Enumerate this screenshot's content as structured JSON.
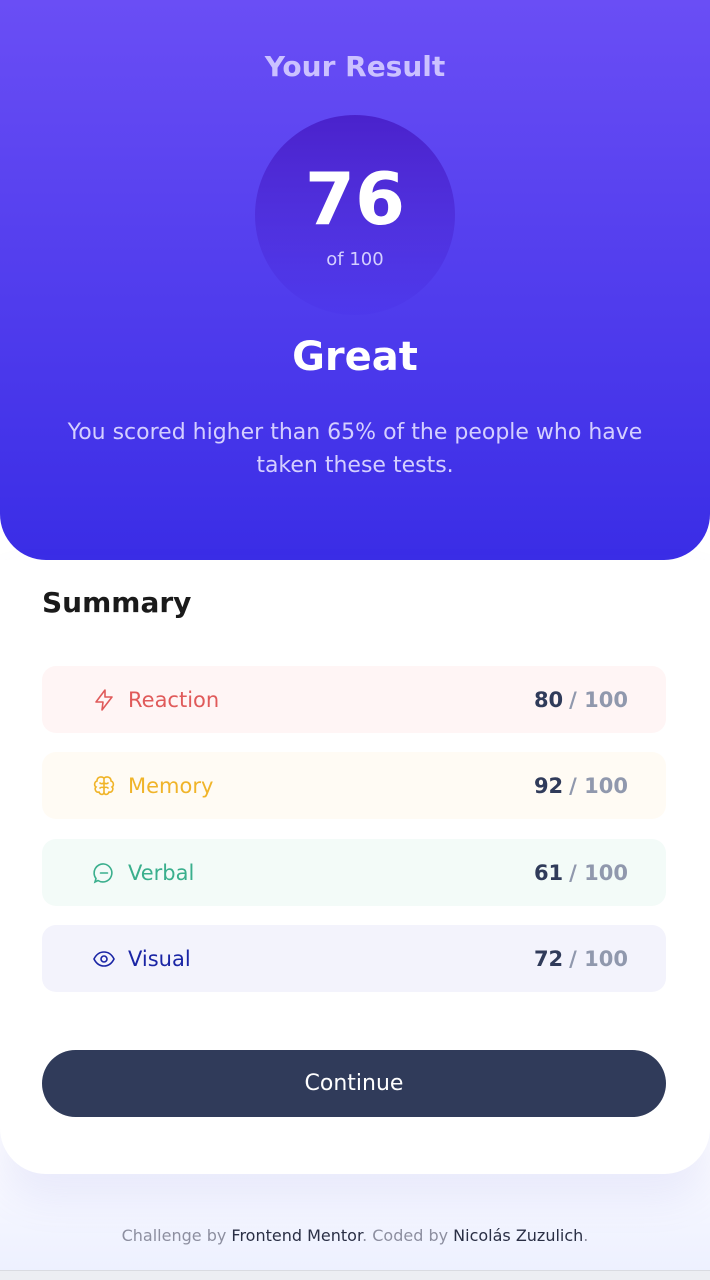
{
  "result": {
    "title": "Your Result",
    "score": "76",
    "score_of": "of 100",
    "rating": "Great",
    "description": "You scored higher than 65% of the people who have taken these tests."
  },
  "summary": {
    "title": "Summary",
    "items": [
      {
        "label": "Reaction",
        "score": "80",
        "total": "/ 100",
        "icon": "lightning-icon",
        "color": "#e05a5a",
        "bg": "#fff5f5"
      },
      {
        "label": "Memory",
        "score": "92",
        "total": "/ 100",
        "icon": "brain-icon",
        "color": "#f0b429",
        "bg": "#fffbf4"
      },
      {
        "label": "Verbal",
        "score": "61",
        "total": "/ 100",
        "icon": "chat-icon",
        "color": "#3aaf8d",
        "bg": "#f3fbf8"
      },
      {
        "label": "Visual",
        "score": "72",
        "total": "/ 100",
        "icon": "eye-icon",
        "color": "#1a25a5",
        "bg": "#f3f3fc"
      }
    ],
    "continue_label": "Continue"
  },
  "footer": {
    "prefix": "Challenge by ",
    "challenge_link": "Frontend Mentor",
    "middle": ". Coded by ",
    "author_link": "Nicolás Zuzulich",
    "suffix": "."
  },
  "colors": {
    "gradient_top": "#6a4ef5",
    "gradient_bottom": "#3a2de6",
    "button": "#303b5a"
  }
}
